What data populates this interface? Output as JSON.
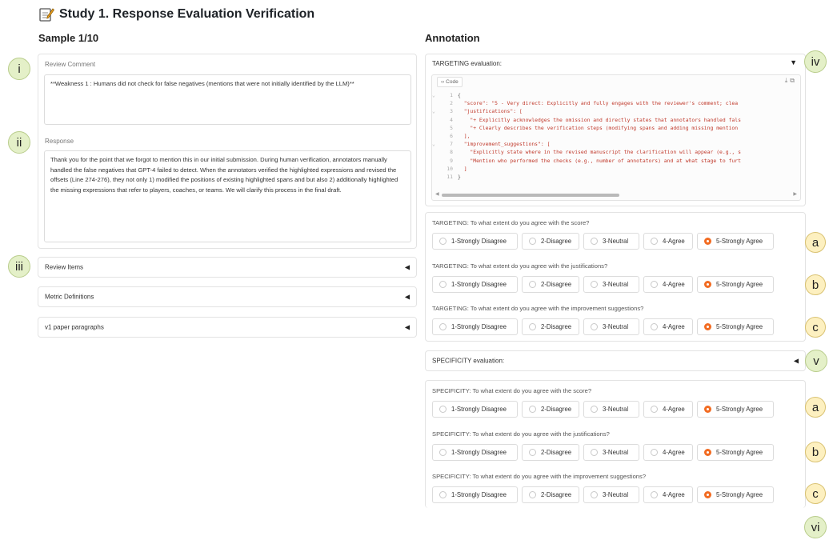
{
  "header": {
    "title": "Study 1. Response Evaluation Verification",
    "icon": "memo-icon"
  },
  "sample": {
    "heading": "Sample 1/10"
  },
  "annotation": {
    "heading": "Annotation"
  },
  "review_comment": {
    "label": "Review Comment",
    "text": "**Weakness 1 : Humans did not check for false negatives (mentions that were not initially identified by the LLM)**"
  },
  "response": {
    "label": "Response",
    "text": "Thank you for the point that we forgot to mention this in our initial submission. During human verification, annotators manually handled the false negatives that GPT-4 failed to detect. When the annotators verified the highlighted expressions and revised the offsets (Line 274-276), they not only 1) modified the positions of existing highlighted spans and but also 2) additionally highlighted the missing expressions that refer to players, coaches, or teams. We will clarify this process in the final draft."
  },
  "left_accordions": [
    {
      "label": "Review Items"
    },
    {
      "label": "Metric Definitions"
    },
    {
      "label": "v1 paper paragraphs"
    }
  ],
  "targeting_eval": {
    "label": "TARGETING evaluation:",
    "code_tab": "Code",
    "code_lines": [
      {
        "n": "1",
        "fold": "⌄",
        "t": "{",
        "dark": true
      },
      {
        "n": "2",
        "fold": "",
        "t": "  \"score\": \"5 - Very direct: Explicitly and fully engages with the reviewer's comment; clea",
        "dark": false
      },
      {
        "n": "3",
        "fold": "⌄",
        "t": "  \"justifications\": [",
        "dark": false
      },
      {
        "n": "4",
        "fold": "",
        "t": "    \"+ Explicitly acknowledges the omission and directly states that annotators handled fals",
        "dark": false
      },
      {
        "n": "5",
        "fold": "",
        "t": "    \"+ Clearly describes the verification steps (modifying spans and adding missing mention",
        "dark": false
      },
      {
        "n": "6",
        "fold": "",
        "t": "  ],",
        "dark": false
      },
      {
        "n": "7",
        "fold": "⌄",
        "t": "  \"improvement_suggestions\": [",
        "dark": false
      },
      {
        "n": "8",
        "fold": "",
        "t": "    \"Explicitly state where in the revised manuscript the clarification will appear (e.g., s",
        "dark": false
      },
      {
        "n": "9",
        "fold": "",
        "t": "    \"Mention who performed the checks (e.g., number of annotators) and at what stage to furt",
        "dark": false
      },
      {
        "n": "10",
        "fold": "",
        "t": "  ]",
        "dark": false
      },
      {
        "n": "11",
        "fold": "",
        "t": "}",
        "dark": true
      }
    ]
  },
  "specificity_eval": {
    "label": "SPECIFICITY evaluation:"
  },
  "options": [
    "1-Strongly Disagree",
    "2-Disagree",
    "3-Neutral",
    "4-Agree",
    "5-Strongly Agree"
  ],
  "targeting_questions": [
    {
      "text": "TARGETING: To what extent do you agree with the score?",
      "selected": 4
    },
    {
      "text": "TARGETING: To what extent do you agree with the justifications?",
      "selected": 4
    },
    {
      "text": "TARGETING: To what extent do you agree with the improvement suggestions?",
      "selected": 4
    }
  ],
  "specificity_questions": [
    {
      "text": "SPECIFICITY: To what extent do you agree with the score?",
      "selected": 4
    },
    {
      "text": "SPECIFICITY: To what extent do you agree with the justifications?",
      "selected": 4
    },
    {
      "text": "SPECIFICITY: To what extent do you agree with the improvement suggestions?",
      "selected": 4
    }
  ],
  "markers": {
    "i": "i",
    "ii": "ii",
    "iii": "iii",
    "iv": "iv",
    "v": "v",
    "vi": "vi",
    "a1": "a",
    "b1": "b",
    "c1": "c",
    "a2": "a",
    "b2": "b",
    "c2": "c"
  },
  "colors": {
    "accent": "#f26b21",
    "marker_green": "#e4f0c8",
    "marker_yellow": "#fdf0c0"
  }
}
